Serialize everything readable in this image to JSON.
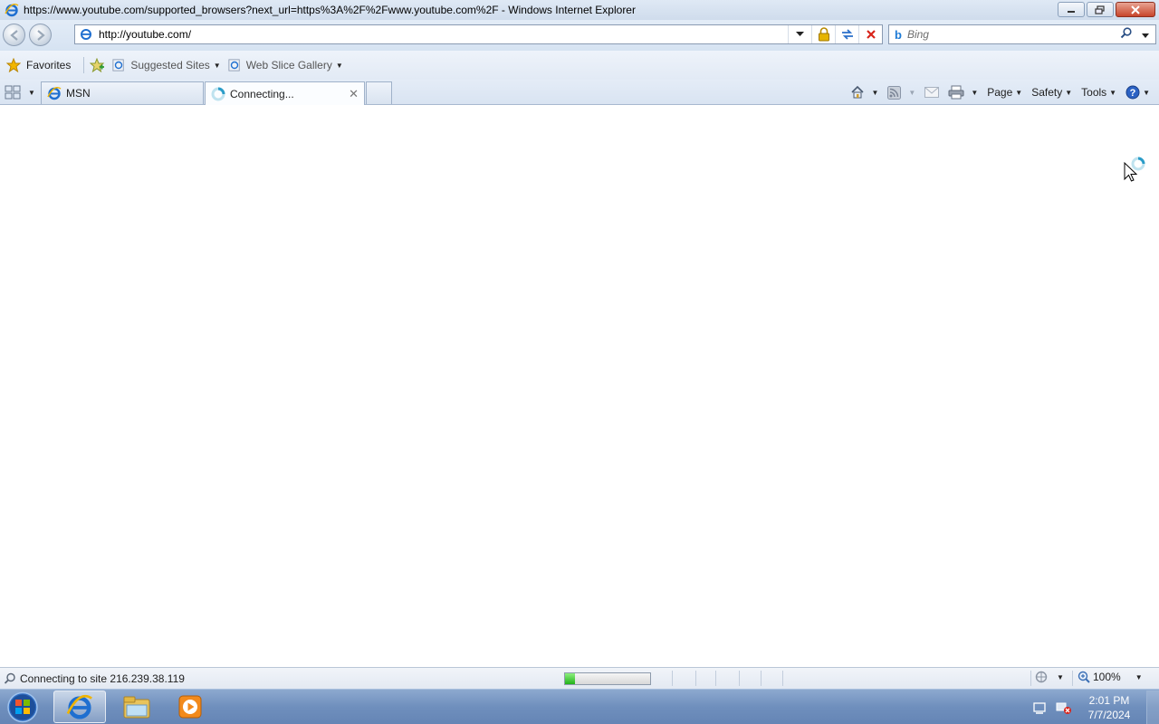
{
  "window": {
    "title": "https://www.youtube.com/supported_browsers?next_url=https%3A%2F%2Fwww.youtube.com%2F - Windows Internet Explorer"
  },
  "address_bar": {
    "url": "http://youtube.com/"
  },
  "search": {
    "placeholder": "Bing"
  },
  "favorites_bar": {
    "favorites_label": "Favorites",
    "items": [
      {
        "label": "Suggested Sites"
      },
      {
        "label": "Web Slice Gallery"
      }
    ]
  },
  "tabs": [
    {
      "label": "MSN"
    },
    {
      "label": "Connecting..."
    }
  ],
  "command_bar": {
    "page_label": "Page",
    "safety_label": "Safety",
    "tools_label": "Tools"
  },
  "status_bar": {
    "text": "Connecting to site 216.239.38.119",
    "progress": 0.12,
    "zoom": "100%"
  },
  "taskbar": {
    "time": "2:01 PM",
    "date": "7/7/2024"
  },
  "colors": {
    "accent": "#1e7bd6",
    "progress_fill": "#22b21a",
    "taskbar": "#6f8fbd"
  }
}
